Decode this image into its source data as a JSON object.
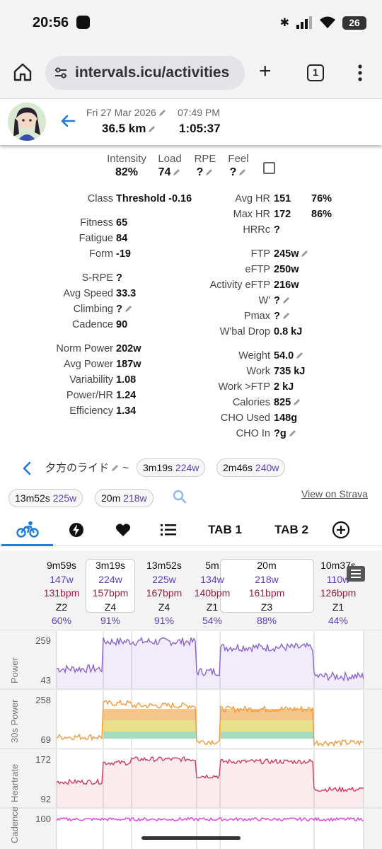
{
  "status": {
    "time": "20:56",
    "battery": "26"
  },
  "browser": {
    "url": "intervals.icu/activities",
    "tab_count": "1"
  },
  "header": {
    "date": "Fri 27 Mar 2026",
    "time": "07:49 PM",
    "distance": "36.5 km",
    "duration": "1:05:37"
  },
  "top_stats": [
    {
      "label": "Intensity",
      "value": "82%"
    },
    {
      "label": "Load",
      "value": "74"
    },
    {
      "label": "RPE",
      "value": "?"
    },
    {
      "label": "Feel",
      "value": "?"
    }
  ],
  "left_stats": [
    {
      "label": "Class",
      "value": "Threshold -0.16"
    },
    {
      "label": "Fitness",
      "value": "65"
    },
    {
      "label": "Fatigue",
      "value": "84"
    },
    {
      "label": "Form",
      "value": "-19"
    },
    {
      "label": "S-RPE",
      "value": "?"
    },
    {
      "label": "Avg Speed",
      "value": "33.3"
    },
    {
      "label": "Climbing",
      "value": "?"
    },
    {
      "label": "Cadence",
      "value": "90"
    },
    {
      "label": "Norm Power",
      "value": "202w"
    },
    {
      "label": "Avg Power",
      "value": "187w"
    },
    {
      "label": "Variability",
      "value": "1.08"
    },
    {
      "label": "Power/HR",
      "value": "1.24"
    },
    {
      "label": "Efficiency",
      "value": "1.34"
    }
  ],
  "right_stats": [
    {
      "label": "Avg HR",
      "value": "151",
      "extra": "76%"
    },
    {
      "label": "Max HR",
      "value": "172",
      "extra": "86%"
    },
    {
      "label": "HRRc",
      "value": "?",
      "extra": ""
    },
    {
      "label": "FTP",
      "value": "245w",
      "extra": ""
    },
    {
      "label": "eFTP",
      "value": "250w",
      "extra": ""
    },
    {
      "label": "Activity eFTP",
      "value": "216w",
      "extra": ""
    },
    {
      "label": "W'",
      "value": "?",
      "extra": ""
    },
    {
      "label": "Pmax",
      "value": "?",
      "extra": ""
    },
    {
      "label": "W'bal Drop",
      "value": "0.8 kJ",
      "extra": ""
    },
    {
      "label": "Weight",
      "value": "54.0",
      "extra": ""
    },
    {
      "label": "Work",
      "value": "735 kJ",
      "extra": ""
    },
    {
      "label": "Work >FTP",
      "value": "2 kJ",
      "extra": ""
    },
    {
      "label": "Calories",
      "value": "825",
      "extra": ""
    },
    {
      "label": "CHO Used",
      "value": "148g",
      "extra": ""
    },
    {
      "label": "CHO In",
      "value": "?g",
      "extra": ""
    }
  ],
  "intervals": {
    "title": "夕方のライド",
    "separator": "~",
    "chips": [
      {
        "duration": "3m19s",
        "power": "224w"
      },
      {
        "duration": "2m46s",
        "power": "240w"
      },
      {
        "duration": "13m52s",
        "power": "225w"
      },
      {
        "duration": "20m",
        "power": "218w"
      }
    ],
    "strava_link": "View on Strava"
  },
  "tabs": [
    "TAB 1",
    "TAB 2"
  ],
  "segments": [
    {
      "name": "9m59s",
      "power": "147w",
      "hr": "131bpm",
      "zone": "Z2",
      "pct": "60%"
    },
    {
      "name": "3m19s",
      "power": "224w",
      "hr": "157bpm",
      "zone": "Z4",
      "pct": "91%"
    },
    {
      "name": "13m52s",
      "power": "225w",
      "hr": "167bpm",
      "zone": "Z4",
      "pct": "91%"
    },
    {
      "name": "5m",
      "power": "134w",
      "hr": "140bpm",
      "zone": "Z1",
      "pct": "54%"
    },
    {
      "name": "20m",
      "power": "218w",
      "hr": "161bpm",
      "zone": "Z3",
      "pct": "88%"
    },
    {
      "name": "10m37s",
      "power": "110w",
      "hr": "126bpm",
      "zone": "Z1",
      "pct": "44%"
    }
  ],
  "panels": [
    {
      "label": "Power",
      "max": "259",
      "min": "43",
      "color": "#8a63d2"
    },
    {
      "label": "30s Power",
      "max": "258",
      "min": "69",
      "color": "#f29a3a"
    },
    {
      "label": "Heartrate",
      "max": "172",
      "min": "92",
      "color": "#d23a63"
    },
    {
      "label": "Cadence",
      "max": "100",
      "min": "",
      "color": "#e040e0"
    }
  ]
}
